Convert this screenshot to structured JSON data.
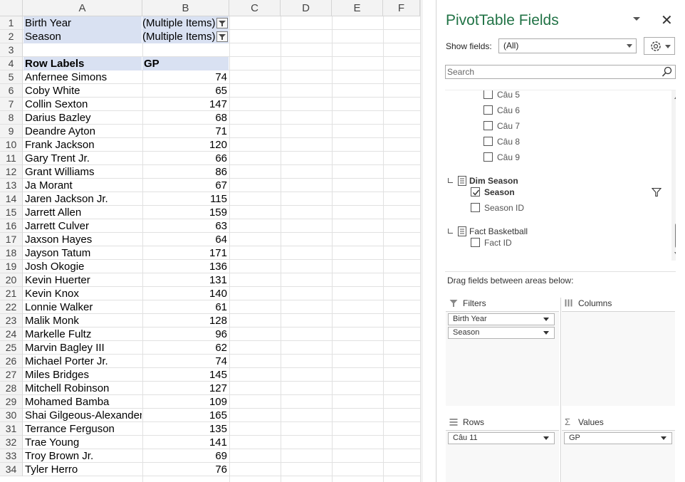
{
  "sheet": {
    "columns": [
      "A",
      "B",
      "C",
      "D",
      "E",
      "F"
    ],
    "row_numbers": [
      "1",
      "2",
      "3",
      "4",
      "5",
      "6",
      "7",
      "8",
      "9",
      "10",
      "11",
      "12",
      "13",
      "14",
      "15",
      "16",
      "17",
      "18",
      "19",
      "20",
      "21",
      "22",
      "23",
      "24",
      "25",
      "26",
      "27",
      "28",
      "29",
      "30",
      "31",
      "32",
      "33",
      "34"
    ],
    "filters": [
      {
        "label": "Birth Year",
        "value": "(Multiple Items)"
      },
      {
        "label": "Season",
        "value": "(Multiple Items)"
      }
    ],
    "header": {
      "row_labels": "Row Labels",
      "gp": "GP"
    },
    "rows": [
      {
        "name": "Anfernee Simons",
        "gp": "74"
      },
      {
        "name": "Coby White",
        "gp": "65"
      },
      {
        "name": "Collin Sexton",
        "gp": "147"
      },
      {
        "name": "Darius Bazley",
        "gp": "68"
      },
      {
        "name": "Deandre Ayton",
        "gp": "71"
      },
      {
        "name": "Frank Jackson",
        "gp": "120"
      },
      {
        "name": "Gary Trent Jr.",
        "gp": "66"
      },
      {
        "name": "Grant Williams",
        "gp": "86"
      },
      {
        "name": "Ja Morant",
        "gp": "67"
      },
      {
        "name": "Jaren Jackson Jr.",
        "gp": "115"
      },
      {
        "name": "Jarrett Allen",
        "gp": "159"
      },
      {
        "name": "Jarrett Culver",
        "gp": "63"
      },
      {
        "name": "Jaxson Hayes",
        "gp": "64"
      },
      {
        "name": "Jayson Tatum",
        "gp": "171"
      },
      {
        "name": "Josh Okogie",
        "gp": "136"
      },
      {
        "name": "Kevin Huerter",
        "gp": "131"
      },
      {
        "name": "Kevin Knox",
        "gp": "140"
      },
      {
        "name": "Lonnie Walker",
        "gp": "61"
      },
      {
        "name": "Malik Monk",
        "gp": "128"
      },
      {
        "name": "Markelle Fultz",
        "gp": "96"
      },
      {
        "name": "Marvin Bagley III",
        "gp": "62"
      },
      {
        "name": "Michael Porter Jr.",
        "gp": "74"
      },
      {
        "name": "Miles Bridges",
        "gp": "145"
      },
      {
        "name": "Mitchell Robinson",
        "gp": "127"
      },
      {
        "name": "Mohamed Bamba",
        "gp": "109"
      },
      {
        "name": "Shai Gilgeous-Alexander",
        "gp": "165"
      },
      {
        "name": "Terrance Ferguson",
        "gp": "135"
      },
      {
        "name": "Trae Young",
        "gp": "141"
      },
      {
        "name": "Troy Brown Jr.",
        "gp": "69"
      },
      {
        "name": "Tyler Herro",
        "gp": "76"
      }
    ]
  },
  "panel": {
    "title": "PivotTable Fields",
    "close": "✕",
    "show_fields_label": "Show fields:",
    "show_fields_value": "(All)",
    "search_placeholder": "Search",
    "fields_top": [
      "Câu 5",
      "Câu 6",
      "Câu 7",
      "Câu 8",
      "Câu 9"
    ],
    "tables": [
      {
        "name": "Dim Season",
        "fields": [
          {
            "label": "Season",
            "checked": true,
            "filtered": true
          },
          {
            "label": "Season ID",
            "checked": false
          }
        ]
      },
      {
        "name": "Fact Basketball",
        "fields": [
          {
            "label": "Fact ID",
            "checked": false
          }
        ]
      }
    ],
    "drag_text": "Drag fields between areas below:",
    "areas": {
      "filters": {
        "title": "Filters",
        "items": [
          "Birth Year",
          "Season"
        ]
      },
      "columns": {
        "title": "Columns",
        "items": []
      },
      "rows": {
        "title": "Rows",
        "items": [
          "Câu 11"
        ]
      },
      "values": {
        "title": "Values",
        "items": [
          "GP"
        ]
      }
    }
  },
  "colors": {
    "accent": "#217346",
    "pivot_band": "#d9e1f2"
  }
}
